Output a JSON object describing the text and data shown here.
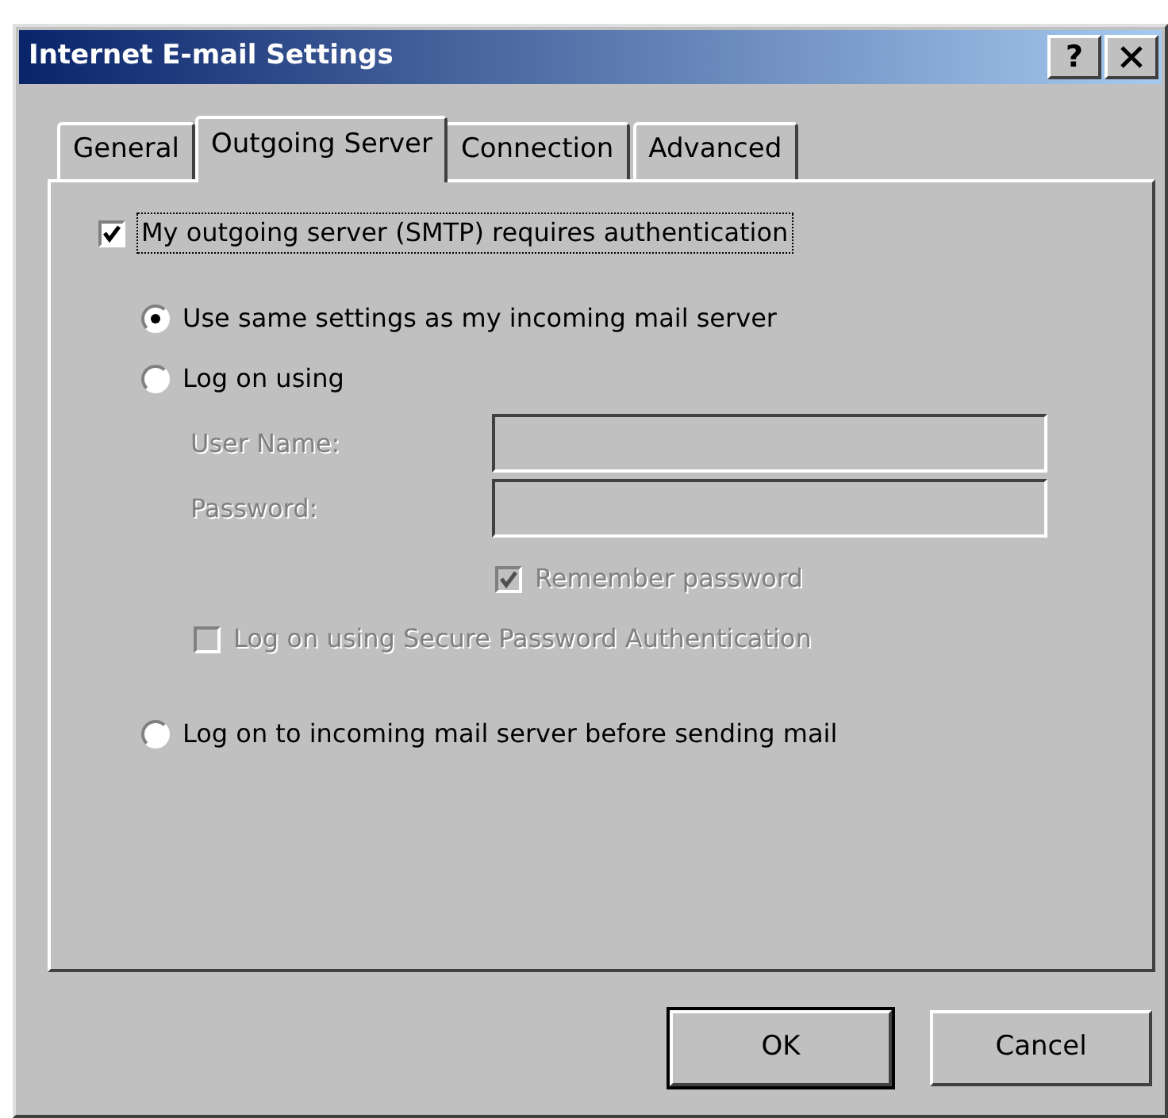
{
  "window": {
    "title": "Internet E-mail Settings",
    "help": "?"
  },
  "tabs": [
    {
      "label": "General",
      "selected": false
    },
    {
      "label": "Outgoing Server",
      "selected": true
    },
    {
      "label": "Connection",
      "selected": false
    },
    {
      "label": "Advanced",
      "selected": false
    }
  ],
  "auth": {
    "label": "My outgoing server (SMTP) requires authentication",
    "checked": true,
    "focused": true
  },
  "options": [
    {
      "kind": "radio",
      "label": "Use same settings as my incoming mail server",
      "selected": true
    },
    {
      "kind": "radio",
      "label": "Log on using",
      "selected": false
    },
    {
      "kind": "field",
      "label": "User Name:",
      "disabled": true
    },
    {
      "kind": "field",
      "label": "Password:",
      "disabled": true
    },
    {
      "kind": "field-checkbox",
      "label": "Remember password",
      "checked": true,
      "disabled": true
    },
    {
      "kind": "checkbox",
      "label": "Log on using Secure Password Authentication",
      "checked": false,
      "disabled": true
    },
    {
      "kind": "radio",
      "label": "Log on to incoming mail server before sending mail",
      "selected": false
    }
  ],
  "buttons": [
    {
      "label": "OK",
      "default": true
    },
    {
      "label": "Cancel",
      "default": false
    }
  ]
}
